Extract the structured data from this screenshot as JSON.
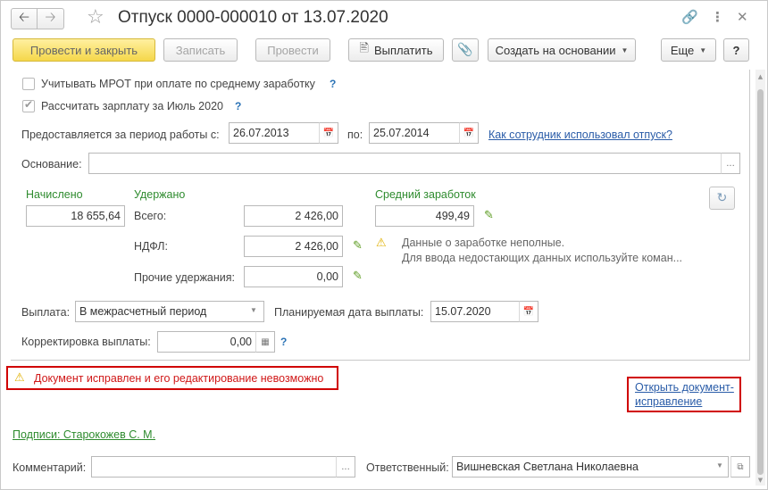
{
  "titlebar": {
    "back_icon": "arrow-left-icon",
    "forward_icon": "arrow-right-icon",
    "title": "Отпуск 0000-000010 от 13.07.2020"
  },
  "toolbar": {
    "post_and_close": "Провести и закрыть",
    "save": "Записать",
    "post": "Провести",
    "pay": "Выплатить",
    "create_based_on": "Создать на основании",
    "more": "Еще",
    "help": "?"
  },
  "form": {
    "mrot_label": "Учитывать МРОТ при оплате по среднему заработку",
    "mrot_help": "?",
    "calc_label": "Рассчитать зарплату за Июль 2020",
    "calc_help": "?",
    "period_label": "Предоставляется за период работы с:",
    "period_from": "26.07.2013",
    "period_to_label": "по:",
    "period_to": "25.07.2014",
    "usage_link": "Как сотрудник использовал отпуск?",
    "basis_label": "Основание:",
    "basis_value": "",
    "accrued_label": "Начислено",
    "accrued_value": "18 655,64",
    "withheld_label": "Удержано",
    "total_label": "Всего:",
    "total_value": "2 426,00",
    "ndfl_label": "НДФЛ:",
    "ndfl_value": "2 426,00",
    "other_label": "Прочие удержания:",
    "other_value": "0,00",
    "avg_label": "Средний заработок",
    "avg_value": "499,49",
    "warn_line1": "Данные о заработке неполные.",
    "warn_line2": "Для ввода недостающих данных используйте коман...",
    "payout_label": "Выплата:",
    "payout_value": "В межрасчетный период",
    "planned_label": "Планируемая дата выплаты:",
    "planned_value": "15.07.2020",
    "correction_label": "Корректировка выплаты:",
    "correction_value": "0,00",
    "correction_help": "?"
  },
  "notice": {
    "error_text": "Документ исправлен и его редактирование невозможно",
    "open_fix_line1": "Открыть документ-",
    "open_fix_line2": "исправление"
  },
  "footer": {
    "signatures_link": "Подписи: Старокожев С. М.",
    "comment_label": "Комментарий:",
    "comment_value": "",
    "responsible_label": "Ответственный:",
    "responsible_value": "Вишневская Светлана Николаевна"
  },
  "colors": {
    "accent_yellow": "#f5d74a",
    "link_blue": "#2a5ca8",
    "green_label": "#2e8b2e",
    "error_red": "#d01818",
    "highlight_box": "#d00000"
  }
}
